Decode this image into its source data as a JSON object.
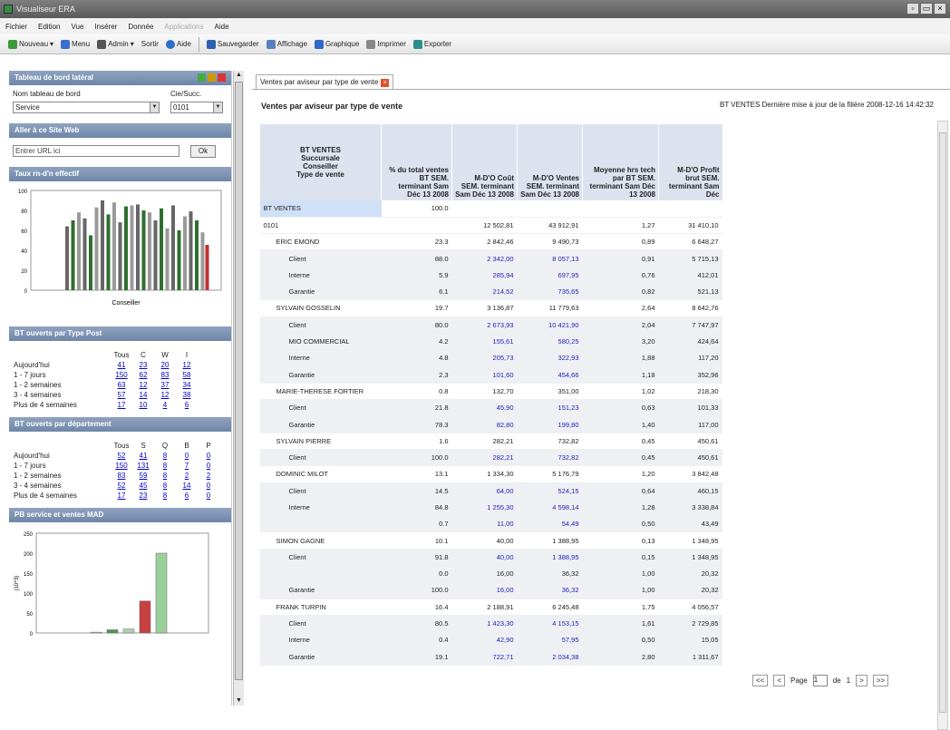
{
  "window": {
    "title": "Visualiseur ERA"
  },
  "menu": [
    "Fichier",
    "Edition",
    "Vue",
    "Insérer",
    "Donnée",
    "Applications",
    "Aide"
  ],
  "toolbar": {
    "nouveau": "Nouveau",
    "menu": "Menu",
    "admin": "Admin",
    "sortir": "Sortir",
    "aide": "Aide",
    "sauvegarder": "Sauvegarder",
    "affichage": "Affichage",
    "graphique": "Graphique",
    "imprimer": "Imprimer",
    "exporter": "Exporter"
  },
  "sidebar": {
    "panel_title": "Tableau de bord latéral",
    "dashboard_name_label": "Nom tableau de bord",
    "dashboard_name_value": "Service",
    "cie_label": "Cie/Succ.",
    "cie_value": "0101",
    "web_title": "Aller à ce Site Web",
    "url_placeholder": "Entrer URL ici",
    "ok": "Ok",
    "rate_title": "Taux rn-d'n effectif",
    "rate_chart": {
      "type": "bar",
      "ylim": [
        0,
        100
      ],
      "yticks": [
        "100",
        "80",
        "60",
        "40",
        "20",
        "0"
      ],
      "xlabel": "Conseiller"
    },
    "bt_type_title": "BT ouverts par Type Post",
    "bt_type_headers": [
      "Tous",
      "C",
      "W",
      "I"
    ],
    "bt_type_rows": [
      {
        "label": "Aujourd'hui",
        "vals": [
          "41",
          "23",
          "20",
          "12"
        ]
      },
      {
        "label": "1 - 7 jours",
        "vals": [
          "150",
          "62",
          "83",
          "58"
        ]
      },
      {
        "label": "1 - 2 semaines",
        "vals": [
          "63",
          "12",
          "37",
          "34"
        ]
      },
      {
        "label": "3 - 4 semaines",
        "vals": [
          "57",
          "14",
          "12",
          "38"
        ]
      },
      {
        "label": "Plus de 4 semaines",
        "vals": [
          "17",
          "10",
          "4",
          "6"
        ]
      }
    ],
    "bt_dept_title": "BT ouverts par département",
    "bt_dept_headers": [
      "Tous",
      "S",
      "Q",
      "B",
      "P"
    ],
    "bt_dept_rows": [
      {
        "label": "Aujourd'hui",
        "vals": [
          "52",
          "41",
          "8",
          "0",
          "0"
        ]
      },
      {
        "label": "1 - 7 jours",
        "vals": [
          "150",
          "131",
          "8",
          "7",
          "0"
        ]
      },
      {
        "label": "1 - 2 semaines",
        "vals": [
          "83",
          "59",
          "8",
          "2",
          "2"
        ]
      },
      {
        "label": "3 - 4 semaines",
        "vals": [
          "52",
          "45",
          "8",
          "14",
          "0"
        ]
      },
      {
        "label": "Plus de 4 semaines",
        "vals": [
          "17",
          "23",
          "8",
          "6",
          "0"
        ]
      }
    ],
    "pb_title": "PB service et ventes MAD",
    "pb_chart": {
      "type": "bar",
      "yticks": [
        "250",
        "200",
        "150",
        "100",
        "50",
        "0"
      ],
      "ylabel": "(10^3)"
    }
  },
  "tab": {
    "label": "Ventes par aviseur  par type de vente"
  },
  "report": {
    "title": "Ventes par aviseur  par type de vente",
    "info": "BT VENTES Dernière mise à jour de la filière 2008-12-16 14:42:32",
    "columns": [
      "BT VENTES\nSuccursale\nConseiller\nType de vente",
      "% du total ventes BT SEM. terminant Sam Déc 13 2008",
      "M-D'O Coût SEM. terminant Sam Déc 13 2008",
      "M-D'O Ventes SEM. terminant Sam Déc 13 2008",
      "Moyenne hrs tech par BT SEM. terminant Sam Déc 13 2008",
      "M-D'O Profit brut SEM. terminant Sam Déc"
    ],
    "rows": [
      {
        "name": "BT VENTES",
        "indent": 0,
        "pct": "100.0",
        "cout": "",
        "ventes": "",
        "moy": "",
        "profit": "",
        "blue": false,
        "sel": true
      },
      {
        "name": "0101",
        "indent": 0,
        "pct": "",
        "cout": "12 502,81",
        "ventes": "43 912,91",
        "moy": "1,27",
        "profit": "31 410,10",
        "blue": false
      },
      {
        "name": "ERIC EMOND",
        "indent": 1,
        "pct": "23.3",
        "cout": "2 842,46",
        "ventes": "9 490,73",
        "moy": "0,89",
        "profit": "6 648,27",
        "blue": false
      },
      {
        "name": "Client",
        "indent": 2,
        "pct": "88.0",
        "cout": "2 342,00",
        "ventes": "8 057,13",
        "moy": "0,91",
        "profit": "5 715,13",
        "blue": true
      },
      {
        "name": "Interne",
        "indent": 2,
        "pct": "5.9",
        "cout": "285,94",
        "ventes": "697,95",
        "moy": "0,76",
        "profit": "412,01",
        "blue": true
      },
      {
        "name": "Garantie",
        "indent": 2,
        "pct": "6.1",
        "cout": "214,52",
        "ventes": "735,65",
        "moy": "0,82",
        "profit": "521,13",
        "blue": true
      },
      {
        "name": "SYLVAIN GOSSELIN",
        "indent": 1,
        "pct": "19.7",
        "cout": "3 136,87",
        "ventes": "11 779,63",
        "moy": "2,64",
        "profit": "8 642,76",
        "blue": false
      },
      {
        "name": "Client",
        "indent": 2,
        "pct": "80.0",
        "cout": "2 673,93",
        "ventes": "10 421,90",
        "moy": "2,04",
        "profit": "7 747,97",
        "blue": true
      },
      {
        "name": "MIO COMMERCIAL",
        "indent": 2,
        "pct": "4.2",
        "cout": "155,61",
        "ventes": "580,25",
        "moy": "3,20",
        "profit": "424,64",
        "blue": true
      },
      {
        "name": "Interne",
        "indent": 2,
        "pct": "4.8",
        "cout": "205,73",
        "ventes": "322,93",
        "moy": "1,88",
        "profit": "117,20",
        "blue": true
      },
      {
        "name": "Garantie",
        "indent": 2,
        "pct": "2.3",
        "cout": "101,60",
        "ventes": "454,66",
        "moy": "1,18",
        "profit": "352,96",
        "blue": true
      },
      {
        "name": "MARIE-THERESE FORTIER",
        "indent": 1,
        "pct": "0.8",
        "cout": "132,70",
        "ventes": "351,00",
        "moy": "1,02",
        "profit": "218,30",
        "blue": false
      },
      {
        "name": "Client",
        "indent": 2,
        "pct": "21.8",
        "cout": "45,90",
        "ventes": "151,23",
        "moy": "0,63",
        "profit": "101,33",
        "blue": true
      },
      {
        "name": "Garantie",
        "indent": 2,
        "pct": "78.3",
        "cout": "82,80",
        "ventes": "199,80",
        "moy": "1,40",
        "profit": "117,00",
        "blue": true
      },
      {
        "name": "SYLVAIN PIERRE",
        "indent": 1,
        "pct": "1.6",
        "cout": "282,21",
        "ventes": "732,82",
        "moy": "0,45",
        "profit": "450,61",
        "blue": false
      },
      {
        "name": "Client",
        "indent": 2,
        "pct": "100.0",
        "cout": "282,21",
        "ventes": "732,82",
        "moy": "0,45",
        "profit": "450,61",
        "blue": true
      },
      {
        "name": "DOMINIC MILOT",
        "indent": 1,
        "pct": "13.1",
        "cout": "1 334,30",
        "ventes": "5 176,79",
        "moy": "1,20",
        "profit": "3 842,48",
        "blue": false
      },
      {
        "name": "Client",
        "indent": 2,
        "pct": "14.5",
        "cout": "64,00",
        "ventes": "524,15",
        "moy": "0,64",
        "profit": "460,15",
        "blue": true
      },
      {
        "name": "Interne",
        "indent": 2,
        "pct": "84.8",
        "cout": "1 255,30",
        "ventes": "4 598,14",
        "moy": "1,28",
        "profit": "3 338,84",
        "blue": true
      },
      {
        "name": "",
        "indent": 2,
        "pct": "0.7",
        "cout": "11,00",
        "ventes": "54,49",
        "moy": "0,50",
        "profit": "43,49",
        "blue": true
      },
      {
        "name": "SIMON GAGNE",
        "indent": 1,
        "pct": "10.1",
        "cout": "40,00",
        "ventes": "1 388,95",
        "moy": "0,13",
        "profit": "1 348,95",
        "blue": false
      },
      {
        "name": "Client",
        "indent": 2,
        "pct": "91.8",
        "cout": "40,00",
        "ventes": "1 388,95",
        "moy": "0,15",
        "profit": "1 348,95",
        "blue": true
      },
      {
        "name": "",
        "indent": 2,
        "pct": "0.0",
        "cout": "16,00",
        "ventes": "36,32",
        "moy": "1,00",
        "profit": "20,32",
        "blue": false
      },
      {
        "name": "Garantie",
        "indent": 2,
        "pct": "100.0",
        "cout": "16,00",
        "ventes": "36,32",
        "moy": "1,00",
        "profit": "20,32",
        "blue": true
      },
      {
        "name": "FRANK TURPIN",
        "indent": 1,
        "pct": "16.4",
        "cout": "2 188,91",
        "ventes": "6 245,48",
        "moy": "1,75",
        "profit": "4 056,57",
        "blue": false
      },
      {
        "name": "Client",
        "indent": 2,
        "pct": "80.5",
        "cout": "1 423,30",
        "ventes": "4 153,15",
        "moy": "1,61",
        "profit": "2 729,85",
        "blue": true
      },
      {
        "name": "Interne",
        "indent": 2,
        "pct": "0.4",
        "cout": "42,90",
        "ventes": "57,95",
        "moy": "0,50",
        "profit": "15,05",
        "blue": true
      },
      {
        "name": "Garantie",
        "indent": 2,
        "pct": "19.1",
        "cout": "722,71",
        "ventes": "2 034,38",
        "moy": "2,80",
        "profit": "1 311,67",
        "blue": true
      }
    ]
  },
  "pager": {
    "first": "<<",
    "prev": "<",
    "page_label": "Page",
    "page_value": "1",
    "of_label": "de",
    "total": "1",
    "next": ">",
    "last": ">>"
  }
}
